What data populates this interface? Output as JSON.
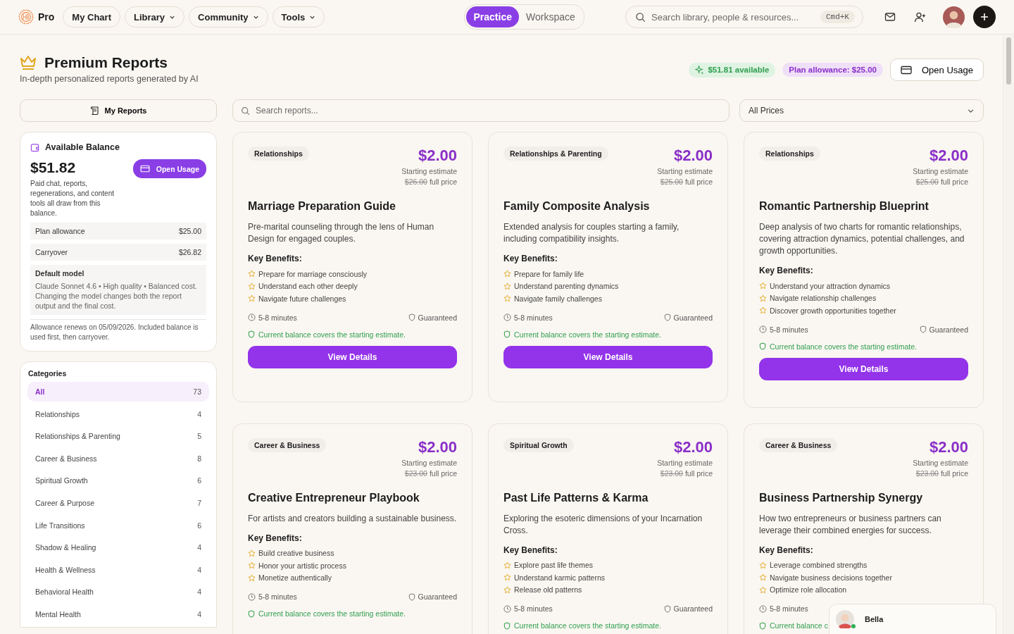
{
  "brand": {
    "name": "Pro"
  },
  "nav": [
    {
      "label": "My Chart",
      "dropdown": false
    },
    {
      "label": "Library",
      "dropdown": true
    },
    {
      "label": "Community",
      "dropdown": true
    },
    {
      "label": "Tools",
      "dropdown": true
    }
  ],
  "mode_tabs": [
    {
      "label": "Practice",
      "selected": true
    },
    {
      "label": "Workspace",
      "selected": false
    }
  ],
  "global_search": {
    "placeholder": "Search library, people & resources...",
    "shortcut": "Cmd+K"
  },
  "header": {
    "title": "Premium Reports",
    "subtitle": "In-depth personalized reports generated by AI",
    "available_badge": "$51.81 available",
    "allowance_badge": "Plan allowance: $25.00",
    "open_usage": "Open Usage"
  },
  "my_reports": "My Reports",
  "report_search": {
    "placeholder": "Search reports..."
  },
  "price_filter": {
    "value": "All Prices"
  },
  "balance": {
    "title": "Available Balance",
    "amount": "$51.82",
    "open_usage": "Open Usage",
    "note": "Paid chat, reports, regenerations, and content tools all draw from this balance.",
    "rows": [
      {
        "label": "Plan allowance",
        "value": "$25.00"
      },
      {
        "label": "Carryover",
        "value": "$26.82"
      }
    ],
    "model_title": "Default model",
    "model_text": "Claude Sonnet 4.6 • High quality • Balanced cost. Changing the model changes both the report output and the final cost.",
    "footer": "Allowance renews on 05/09/2026. Included balance is used first, then carryover."
  },
  "categories": {
    "title": "Categories",
    "items": [
      {
        "label": "All",
        "count": "73",
        "selected": true
      },
      {
        "label": "Relationships",
        "count": "4",
        "selected": false
      },
      {
        "label": "Relationships & Parenting",
        "count": "5",
        "selected": false
      },
      {
        "label": "Career & Business",
        "count": "8",
        "selected": false
      },
      {
        "label": "Spiritual Growth",
        "count": "6",
        "selected": false
      },
      {
        "label": "Career & Purpose",
        "count": "7",
        "selected": false
      },
      {
        "label": "Life Transitions",
        "count": "6",
        "selected": false
      },
      {
        "label": "Shadow & Healing",
        "count": "4",
        "selected": false
      },
      {
        "label": "Health & Wellness",
        "count": "4",
        "selected": false
      },
      {
        "label": "Behavioral Health",
        "count": "4",
        "selected": false
      },
      {
        "label": "Mental Health",
        "count": "4",
        "selected": false
      }
    ]
  },
  "reports": [
    {
      "tag": "Relationships",
      "price": "$2.00",
      "estimate": "Starting estimate",
      "full_price": "$26.00",
      "full_suffix": "full price",
      "title": "Marriage Preparation Guide",
      "description": "Pre-marital counseling through the lens of Human Design for engaged couples.",
      "benefits_heading": "Key Benefits:",
      "benefits": [
        "Prepare for marriage consciously",
        "Understand each other deeply",
        "Navigate future challenges"
      ],
      "duration": "5-8 minutes",
      "guarantee": "Guaranteed",
      "coverage": "Current balance covers the starting estimate.",
      "button": "View Details"
    },
    {
      "tag": "Relationships & Parenting",
      "price": "$2.00",
      "estimate": "Starting estimate",
      "full_price": "$25.00",
      "full_suffix": "full price",
      "title": "Family Composite Analysis",
      "description": "Extended analysis for couples starting a family, including compatibility insights.",
      "benefits_heading": "Key Benefits:",
      "benefits": [
        "Prepare for family life",
        "Understand parenting dynamics",
        "Navigate family challenges"
      ],
      "duration": "5-8 minutes",
      "guarantee": "Guaranteed",
      "coverage": "Current balance covers the starting estimate.",
      "button": "View Details"
    },
    {
      "tag": "Relationships",
      "price": "$2.00",
      "estimate": "Starting estimate",
      "full_price": "$25.00",
      "full_suffix": "full price",
      "title": "Romantic Partnership Blueprint",
      "description": "Deep analysis of two charts for romantic relationships, covering attraction dynamics, potential challenges, and growth opportunities.",
      "benefits_heading": "Key Benefits:",
      "benefits": [
        "Understand your attraction dynamics",
        "Navigate relationship challenges",
        "Discover growth opportunities together"
      ],
      "duration": "5-8 minutes",
      "guarantee": "Guaranteed",
      "coverage": "Current balance covers the starting estimate.",
      "button": "View Details"
    },
    {
      "tag": "Career & Business",
      "price": "$2.00",
      "estimate": "Starting estimate",
      "full_price": "$23.00",
      "full_suffix": "full price",
      "title": "Creative Entrepreneur Playbook",
      "description": "For artists and creators building a sustainable business.",
      "benefits_heading": "Key Benefits:",
      "benefits": [
        "Build creative business",
        "Honor your artistic process",
        "Monetize authentically"
      ],
      "duration": "5-8 minutes",
      "guarantee": "Guaranteed",
      "coverage": "Current balance covers the starting estimate."
    },
    {
      "tag": "Spiritual Growth",
      "price": "$2.00",
      "estimate": "Starting estimate",
      "full_price": "$23.00",
      "full_suffix": "full price",
      "title": "Past Life Patterns & Karma",
      "description": "Exploring the esoteric dimensions of your Incarnation Cross.",
      "benefits_heading": "Key Benefits:",
      "benefits": [
        "Explore past life themes",
        "Understand karmic patterns",
        "Release old patterns"
      ],
      "duration": "5-8 minutes",
      "guarantee": "Guaranteed",
      "coverage": "Current balance covers the starting estimate."
    },
    {
      "tag": "Career & Business",
      "price": "$2.00",
      "estimate": "Starting estimate",
      "full_price": "$23.00",
      "full_suffix": "full price",
      "title": "Business Partnership Synergy",
      "description": "How two entrepreneurs or business partners can leverage their combined energies for success.",
      "benefits_heading": "Key Benefits:",
      "benefits": [
        "Leverage combined strengths",
        "Navigate business decisions together",
        "Optimize role allocation"
      ],
      "duration": "5-8 minutes",
      "coverage": "Current balance c"
    }
  ],
  "chat": {
    "name": "Bella",
    "online": true
  }
}
